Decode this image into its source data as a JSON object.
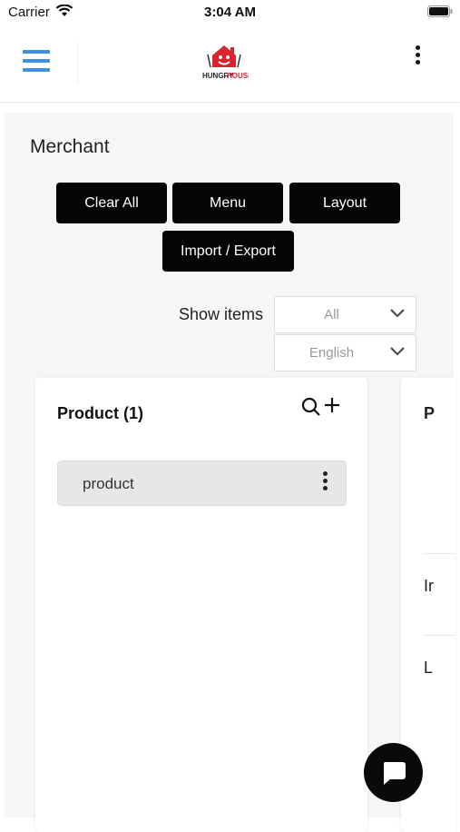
{
  "status_bar": {
    "carrier": "Carrier",
    "time": "3:04 AM"
  },
  "header": {
    "logo_text_a": "HUNGRY",
    "logo_text_b": "HOUSE"
  },
  "page": {
    "title": "Merchant",
    "buttons": {
      "clear_all": "Clear All",
      "menu": "Menu",
      "layout": "Layout",
      "import_export": "Import / Export"
    },
    "show_items_label": "Show items",
    "show_items_value": "All",
    "language_value": "English"
  },
  "product_card": {
    "title": "Product (1)",
    "items": [
      {
        "label": "product"
      }
    ]
  },
  "second_card": {
    "title_fragment": "P",
    "row1_fragment": "Ir",
    "row2_fragment": "L"
  },
  "icons": {
    "menu": "hamburger-icon",
    "more": "more-vert-icon",
    "search": "search-icon",
    "add": "plus-icon",
    "chevron": "chevron-down-icon",
    "chat": "chat-icon"
  },
  "colors": {
    "accent": "#3d8fe0",
    "button_bg": "#050505",
    "logo_red": "#d9232d"
  }
}
